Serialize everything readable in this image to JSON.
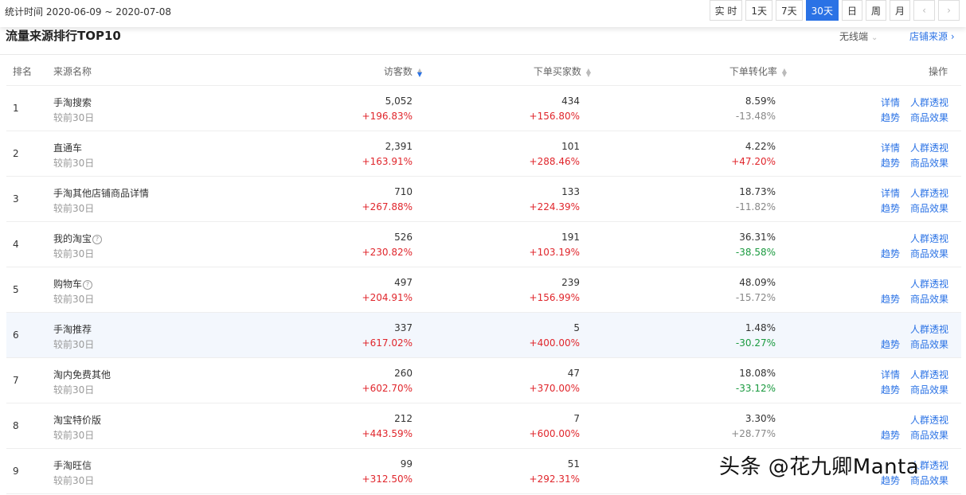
{
  "header": {
    "stat_range": "统计时间 2020-06-09 ~ 2020-07-08",
    "periods": [
      "实 时",
      "1天",
      "7天",
      "30天",
      "日",
      "周",
      "月"
    ],
    "active_period": "30天",
    "prev_icon": "‹",
    "next_icon": "›"
  },
  "section": {
    "title": "流量来源排行TOP10",
    "device": "无线端",
    "device_icon": "chevron-down",
    "source_link": "店铺来源",
    "source_link_icon": "chevron-right"
  },
  "columns": {
    "rank": "排名",
    "source": "来源名称",
    "visitors": "访客数",
    "buyers": "下单买家数",
    "conversion": "下单转化率",
    "action": "操作"
  },
  "rows": [
    {
      "rank": "1",
      "source": "手淘搜索",
      "compare": "较前30日",
      "visitors": "5,052",
      "visitors_delta": "+196.83%",
      "buyers": "434",
      "buyers_delta": "+156.80%",
      "conversion": "8.59%",
      "conversion_delta": "-13.48%",
      "conv_trend": "neutral",
      "has_detail": true,
      "has_help": false,
      "highlight": false
    },
    {
      "rank": "2",
      "source": "直通车",
      "compare": "较前30日",
      "visitors": "2,391",
      "visitors_delta": "+163.91%",
      "buyers": "101",
      "buyers_delta": "+288.46%",
      "conversion": "4.22%",
      "conversion_delta": "+47.20%",
      "conv_trend": "up",
      "has_detail": true,
      "has_help": false,
      "highlight": false
    },
    {
      "rank": "3",
      "source": "手淘其他店铺商品详情",
      "compare": "较前30日",
      "visitors": "710",
      "visitors_delta": "+267.88%",
      "buyers": "133",
      "buyers_delta": "+224.39%",
      "conversion": "18.73%",
      "conversion_delta": "-11.82%",
      "conv_trend": "neutral",
      "has_detail": true,
      "has_help": false,
      "highlight": false
    },
    {
      "rank": "4",
      "source": "我的淘宝",
      "compare": "较前30日",
      "visitors": "526",
      "visitors_delta": "+230.82%",
      "buyers": "191",
      "buyers_delta": "+103.19%",
      "conversion": "36.31%",
      "conversion_delta": "-38.58%",
      "conv_trend": "down",
      "has_detail": false,
      "has_help": true,
      "highlight": false
    },
    {
      "rank": "5",
      "source": "购物车",
      "compare": "较前30日",
      "visitors": "497",
      "visitors_delta": "+204.91%",
      "buyers": "239",
      "buyers_delta": "+156.99%",
      "conversion": "48.09%",
      "conversion_delta": "-15.72%",
      "conv_trend": "neutral",
      "has_detail": false,
      "has_help": true,
      "highlight": false
    },
    {
      "rank": "6",
      "source": "手淘推荐",
      "compare": "较前30日",
      "visitors": "337",
      "visitors_delta": "+617.02%",
      "buyers": "5",
      "buyers_delta": "+400.00%",
      "conversion": "1.48%",
      "conversion_delta": "-30.27%",
      "conv_trend": "down",
      "has_detail": false,
      "has_help": false,
      "highlight": true
    },
    {
      "rank": "7",
      "source": "淘内免费其他",
      "compare": "较前30日",
      "visitors": "260",
      "visitors_delta": "+602.70%",
      "buyers": "47",
      "buyers_delta": "+370.00%",
      "conversion": "18.08%",
      "conversion_delta": "-33.12%",
      "conv_trend": "down",
      "has_detail": true,
      "has_help": false,
      "highlight": false
    },
    {
      "rank": "8",
      "source": "淘宝特价版",
      "compare": "较前30日",
      "visitors": "212",
      "visitors_delta": "+443.59%",
      "buyers": "7",
      "buyers_delta": "+600.00%",
      "conversion": "3.30%",
      "conversion_delta": "+28.77%",
      "conv_trend": "neutral",
      "has_detail": false,
      "has_help": false,
      "highlight": false
    },
    {
      "rank": "9",
      "source": "手淘旺信",
      "compare": "较前30日",
      "visitors": "99",
      "visitors_delta": "+312.50%",
      "buyers": "51",
      "buyers_delta": "+292.31%",
      "conversion": "",
      "conversion_delta": "",
      "conv_trend": "neutral",
      "has_detail": false,
      "has_help": false,
      "highlight": false
    }
  ],
  "actions": {
    "detail": "详情",
    "crowd": "人群透视",
    "trend": "趋势",
    "goods": "商品效果"
  },
  "watermark": "头条 @花九卿Manta",
  "colors": {
    "accent": "#2a72e5",
    "up": "#e0262c",
    "down": "#1a9a3f",
    "neutral": "#888888",
    "highlight_row": "#f3f7fd"
  }
}
